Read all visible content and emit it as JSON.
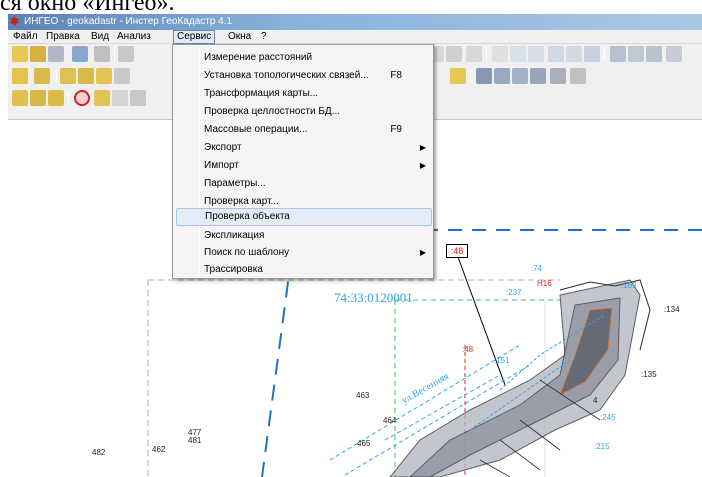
{
  "doc_fragment": "ся окно «Ингео».",
  "window": {
    "title": "ИНГЕО - geokadastr - Инстер ГеоКадастр 4.1",
    "app_icon": "ingeo-logo-icon"
  },
  "menubar": {
    "items": [
      "Файл",
      "Правка",
      "Вид",
      "Анализ",
      "Сервис",
      "Окна",
      "?"
    ],
    "active": "Сервис"
  },
  "dropdown": {
    "items": [
      {
        "label": "Измерение расстояний",
        "shortcut": "",
        "submenu": false
      },
      {
        "label": "Установка топологических связей...",
        "shortcut": "F8",
        "submenu": false
      },
      {
        "label": "Трансформация карты...",
        "shortcut": "",
        "submenu": false
      },
      {
        "label": "Проверка целлостности БД...",
        "shortcut": "",
        "submenu": false
      },
      {
        "label": "Массовые операции...",
        "shortcut": "F9",
        "submenu": false
      },
      {
        "label": "Экспорт",
        "shortcut": "",
        "submenu": true
      },
      {
        "label": "Импорт",
        "shortcut": "",
        "submenu": true
      },
      {
        "label": "Параметры...",
        "shortcut": "",
        "submenu": false
      },
      {
        "label": "Проверка карт...",
        "shortcut": "",
        "submenu": false
      },
      {
        "label": "Проверка объекта",
        "shortcut": "",
        "submenu": false,
        "highlighted": true
      },
      {
        "label": "Экспликация",
        "shortcut": "",
        "submenu": false
      },
      {
        "label": "Поиск по шаблону",
        "shortcut": "",
        "submenu": true
      },
      {
        "label": "Трассировка",
        "shortcut": "",
        "submenu": false
      }
    ]
  },
  "map": {
    "cadastral_number": "74:33:0120001",
    "street_label": "ул.Весенняя",
    "boxed_label": ":48",
    "parcel_labels": [
      {
        "text": "463",
        "color": "dark"
      },
      {
        "text": "464",
        "color": "dark"
      },
      {
        "text": "465",
        "color": "dark"
      },
      {
        "text": "477",
        "color": "dark"
      },
      {
        "text": "481",
        "color": "dark"
      },
      {
        "text": "482",
        "color": "dark"
      },
      {
        "text": "462",
        "color": "dark"
      },
      {
        "text": ":48",
        "color": "red"
      },
      {
        "text": ":74",
        "color": "cyan"
      },
      {
        "text": ":237",
        "color": "cyan"
      },
      {
        "text": "Н16",
        "color": "red"
      },
      {
        "text": ":169",
        "color": "cyan"
      },
      {
        "text": ":134",
        "color": "dark"
      },
      {
        "text": ":151",
        "color": "cyan"
      },
      {
        "text": ":245",
        "color": "cyan"
      },
      {
        "text": ":215",
        "color": "cyan"
      },
      {
        "text": ":135",
        "color": "dark"
      },
      {
        "text": "4",
        "color": "dark"
      }
    ]
  },
  "colors": {
    "accent": "#2aa8e0",
    "alert": "#e02020",
    "menu_highlight": "#e4ecf7"
  }
}
